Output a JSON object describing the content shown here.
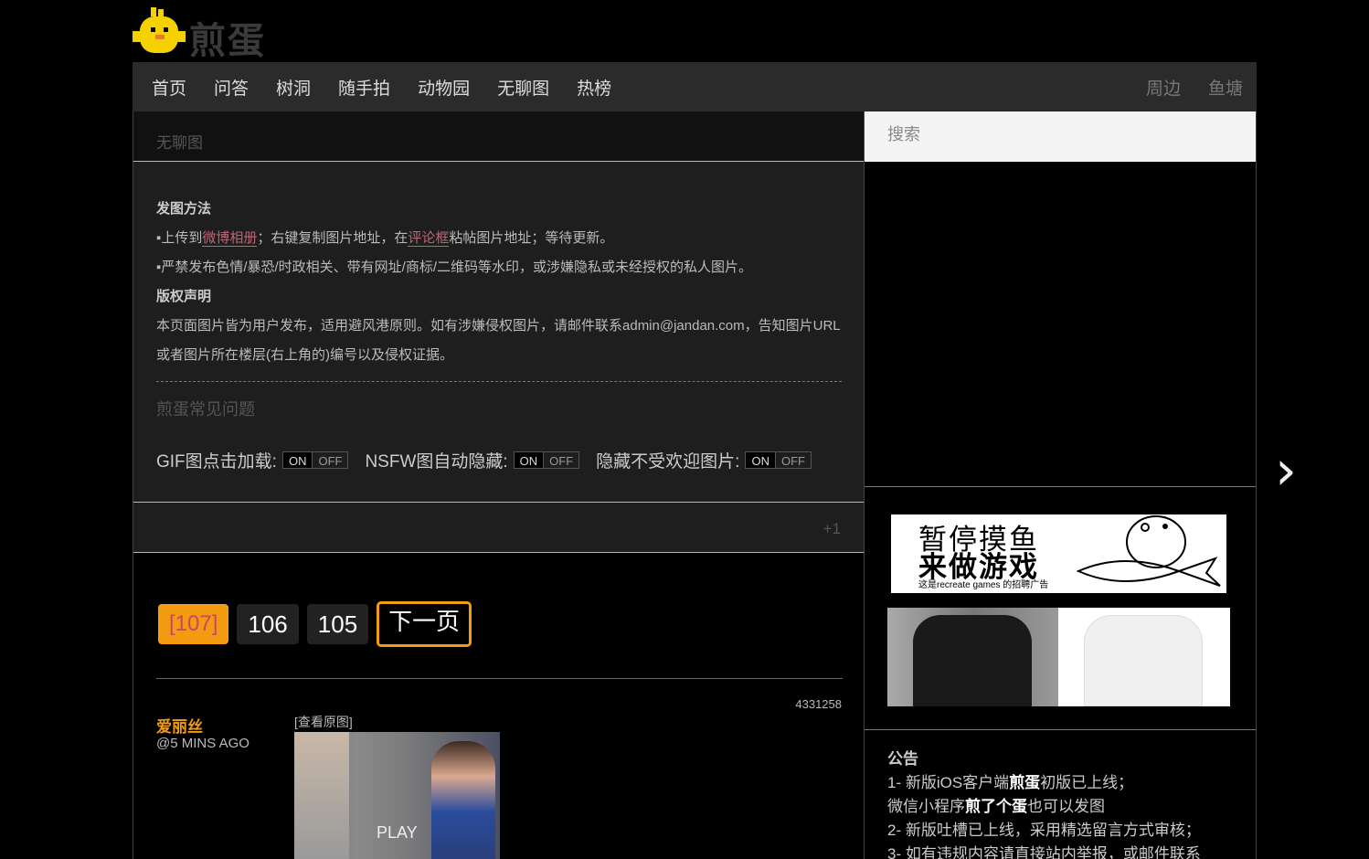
{
  "logo": {
    "text": "煎蛋",
    "icon": "chick-icon"
  },
  "nav": {
    "left": [
      "首页",
      "问答",
      "树洞",
      "随手拍",
      "动物园",
      "无聊图",
      "热榜"
    ],
    "right": [
      "周边",
      "鱼塘"
    ]
  },
  "section_title": "无聊图",
  "info": {
    "post_heading": "发图方法",
    "rule1_prefix": "▪上传到",
    "rule1_link1": "微博相册",
    "rule1_mid": "；右键复制图片地址，在",
    "rule1_link2": "评论框",
    "rule1_suffix": "粘帖图片地址；等待更新。",
    "rule2": "▪严禁发布色情/暴恐/时政相关、带有网址/商标/二维码等水印，或涉嫌隐私或未经授权的私人图片。",
    "copyright_heading": "版权声明",
    "copyright_text": "本页面图片皆为用户发布，适用避风港原则。如有涉嫌侵权图片，请邮件联系admin@jandan.com，告知图片URL或者图片所在楼层(右上角的)编号以及侵权证据。",
    "faq": "煎蛋常见问题"
  },
  "toggles": {
    "gif_label": "GIF图点击加载:",
    "nsfw_label": "NSFW图自动隐藏:",
    "unpopular_label": "隐藏不受欢迎图片:",
    "on": "ON",
    "off": "OFF"
  },
  "plus_one": "+1",
  "pager": {
    "current": "[107]",
    "p2": "106",
    "p3": "105",
    "next": "下一页"
  },
  "post": {
    "id": "4331258",
    "author": "爱丽丝",
    "time": "@5 MINS AGO",
    "view_original": "[查看原图]",
    "play": "PLAY"
  },
  "sidebar": {
    "search_placeholder": "搜索",
    "ad_line1": "暂停摸鱼",
    "ad_line2": "来做游戏",
    "ad_line3": "这是recreate games 的招聘广告",
    "notice_title": "公告",
    "notice_1a": "1- 新版iOS客户端",
    "notice_1b": "煎蛋",
    "notice_1c": "初版已上线；",
    "notice_1d": "微信小程序",
    "notice_1e": "煎了个蛋",
    "notice_1f": "也可以发图",
    "notice_2": "2- 新版吐槽已上线，采用精选留言方式审核；",
    "notice_3": "3- 如有违规内容请直接站内举报，或邮件联系"
  },
  "next_arrow": "›"
}
